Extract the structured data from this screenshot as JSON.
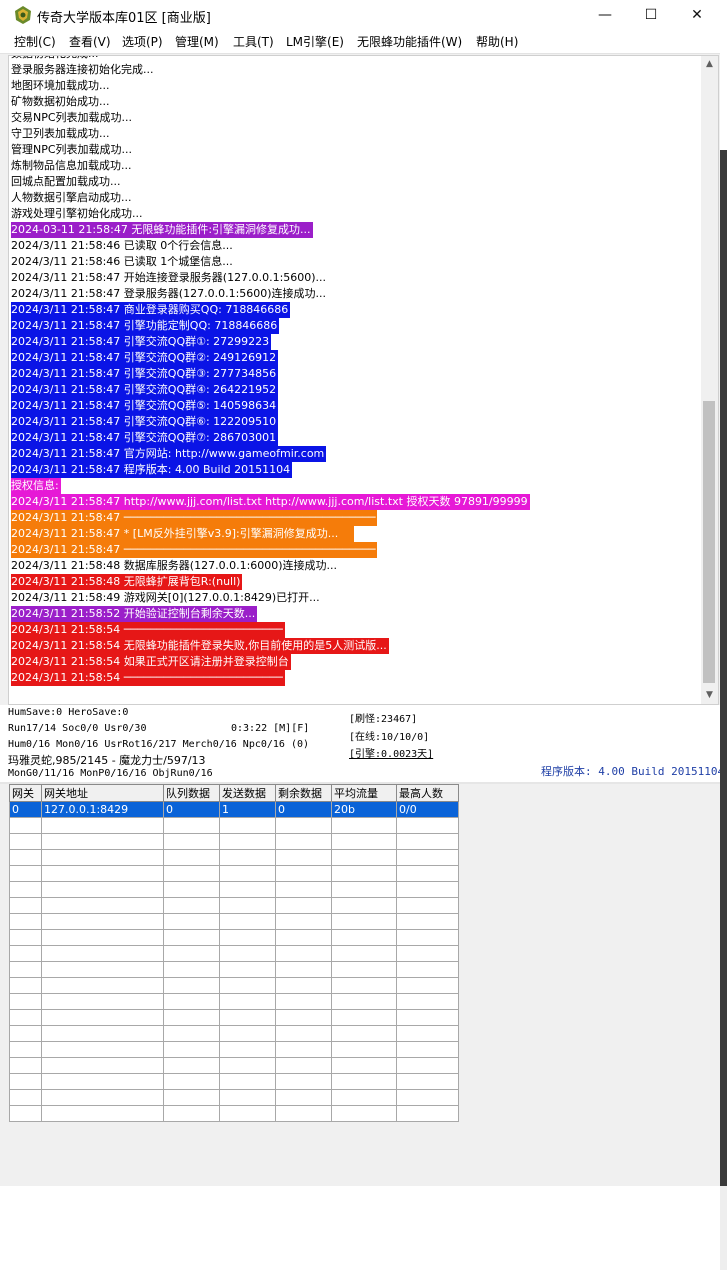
{
  "window": {
    "title": "传奇大学版本库01区 [商业版]",
    "minimize": "—",
    "maximize": "☐",
    "close": "✕"
  },
  "menu": [
    "控制(C)",
    "查看(V)",
    "选项(P)",
    "管理(M)",
    "工具(T)",
    "LM引擎(E)",
    "无限蜂功能插件(W)",
    "帮助(H)"
  ],
  "log": [
    {
      "text": "数据初始化完成...",
      "fg": "#000000",
      "bg": ""
    },
    {
      "text": "登录服务器连接初始化完成...",
      "fg": "#000000",
      "bg": ""
    },
    {
      "text": "地图环境加载成功...",
      "fg": "#000000",
      "bg": ""
    },
    {
      "text": "矿物数据初始成功...",
      "fg": "#000000",
      "bg": ""
    },
    {
      "text": "交易NPC列表加载成功...",
      "fg": "#000000",
      "bg": ""
    },
    {
      "text": "守卫列表加载成功...",
      "fg": "#000000",
      "bg": ""
    },
    {
      "text": "管理NPC列表加载成功...",
      "fg": "#000000",
      "bg": ""
    },
    {
      "text": "炼制物品信息加载成功...",
      "fg": "#000000",
      "bg": ""
    },
    {
      "text": "回城点配置加载成功...",
      "fg": "#000000",
      "bg": ""
    },
    {
      "text": "人物数据引擎启动成功...",
      "fg": "#000000",
      "bg": ""
    },
    {
      "text": "游戏处理引擎初始化成功...",
      "fg": "#000000",
      "bg": ""
    },
    {
      "text": "2024-03-11 21:58:47 无限蜂功能插件:引擎漏洞修复成功...",
      "fg": "#ffffff",
      "bg": "#9b1fc9"
    },
    {
      "text": "2024/3/11 21:58:46 已读取 0个行会信息...",
      "fg": "#000000",
      "bg": ""
    },
    {
      "text": "2024/3/11 21:58:46 已读取 1个城堡信息...",
      "fg": "#000000",
      "bg": ""
    },
    {
      "text": "2024/3/11 21:58:47 开始连接登录服务器(127.0.0.1:5600)...",
      "fg": "#000000",
      "bg": ""
    },
    {
      "text": "2024/3/11 21:58:47 登录服务器(127.0.0.1:5600)连接成功...",
      "fg": "#000000",
      "bg": ""
    },
    {
      "text": "2024/3/11 21:58:47 商业登录器购买QQ: 718846686",
      "fg": "#ffffff",
      "bg": "#0a14e6"
    },
    {
      "text": "2024/3/11 21:58:47 引擎功能定制QQ: 718846686",
      "fg": "#ffffff",
      "bg": "#0a14e6"
    },
    {
      "text": "2024/3/11 21:58:47 引擎交流QQ群①: 27299223",
      "fg": "#ffffff",
      "bg": "#0a14e6"
    },
    {
      "text": "2024/3/11 21:58:47 引擎交流QQ群②: 249126912",
      "fg": "#ffffff",
      "bg": "#0a14e6"
    },
    {
      "text": "2024/3/11 21:58:47 引擎交流QQ群③: 277734856",
      "fg": "#ffffff",
      "bg": "#0a14e6"
    },
    {
      "text": "2024/3/11 21:58:47 引擎交流QQ群④: 264221952",
      "fg": "#ffffff",
      "bg": "#0a14e6"
    },
    {
      "text": "2024/3/11 21:58:47 引擎交流QQ群⑤: 140598634",
      "fg": "#ffffff",
      "bg": "#0a14e6"
    },
    {
      "text": "2024/3/11 21:58:47 引擎交流QQ群⑥: 122209510",
      "fg": "#ffffff",
      "bg": "#0a14e6"
    },
    {
      "text": "2024/3/11 21:58:47 引擎交流QQ群⑦: 286703001",
      "fg": "#ffffff",
      "bg": "#0a14e6"
    },
    {
      "text": "2024/3/11 21:58:47 官方网站: http://www.gameofmir.com",
      "fg": "#ffffff",
      "bg": "#0a14e6"
    },
    {
      "text": "2024/3/11 21:58:47 程序版本: 4.00 Build 20151104",
      "fg": "#ffffff",
      "bg": "#0a14e6"
    },
    {
      "text": "授权信息:",
      "fg": "#ffffff",
      "bg": "#e619d6"
    },
    {
      "text": "2024/3/11 21:58:47 http://www.jjj.com/list.txt http://www.jjj.com/list.txt 授权天数 97891/99999",
      "fg": "#ffffff",
      "bg": "#e619d6"
    },
    {
      "text": "2024/3/11 21:58:47 ──────────────────────────────────────",
      "fg": "#ffffff",
      "bg": "#f57c0a"
    },
    {
      "text": "2024/3/11 21:58:47 * [LM反外挂引擎v3.9]:引擎漏洞修复成功...    ",
      "fg": "#ffffff",
      "bg": "#f57c0a"
    },
    {
      "text": "2024/3/11 21:58:47 ──────────────────────────────────────",
      "fg": "#ffffff",
      "bg": "#f57c0a"
    },
    {
      "text": "2024/3/11 21:58:48 数据库服务器(127.0.0.1:6000)连接成功...",
      "fg": "#000000",
      "bg": ""
    },
    {
      "text": "2024/3/11 21:58:48 无限蜂扩展背包R:(null)",
      "fg": "#ffffff",
      "bg": "#e61717"
    },
    {
      "text": "2024/3/11 21:58:49 游戏网关[0](127.0.0.1:8429)已打开...",
      "fg": "#000000",
      "bg": ""
    },
    {
      "text": "2024/3/11 21:58:52 开始验证控制台剩余天数...",
      "fg": "#ffffff",
      "bg": "#9b1fc9"
    },
    {
      "text": "2024/3/11 21:58:54 ────────────────────────",
      "fg": "#ffffff",
      "bg": "#e61717"
    },
    {
      "text": "2024/3/11 21:58:54 无限蜂功能插件登录失败,你目前使用的是5人测试版...",
      "fg": "#ffffff",
      "bg": "#e61717"
    },
    {
      "text": "2024/3/11 21:58:54 如果正式开区请注册并登录控制台",
      "fg": "#ffffff",
      "bg": "#e61717"
    },
    {
      "text": "2024/3/11 21:58:54 ────────────────────────",
      "fg": "#ffffff",
      "bg": "#e61717"
    }
  ],
  "status": {
    "line1": "HumSave:0 HeroSave:0",
    "line2": "Run17/14 Soc0/0 Usr0/30",
    "time": "0:3:22 [M][F]",
    "line3": "Hum0/16 Mon0/16 UsrRot16/217 Merch0/16 Npc0/16 (0)",
    "line4": "玛雅灵蛇,985/2145 - 魔龙力士/597/13",
    "line5": "MonG0/11/16 MonP0/16/16 ObjRun0/16",
    "refresh": "[刷怪:23467]",
    "online": "[在线:10/10/0]",
    "engine": "[引擎:0.0023天]",
    "version": "程序版本: 4.00 Build 20151104"
  },
  "grid": {
    "headers": [
      "网关",
      "网关地址",
      "队列数据",
      "发送数据",
      "剩余数据",
      "平均流量",
      "最高人数"
    ],
    "rows": [
      [
        "0",
        "127.0.0.1:8429",
        "0",
        "1",
        "0",
        "20b",
        "0/0"
      ]
    ],
    "empty_rows": 19
  },
  "colors": {
    "purple": "#9b1fc9",
    "blue": "#0a14e6",
    "magenta": "#e619d6",
    "orange": "#f57c0a",
    "red": "#e61717",
    "selection": "#0a63d8",
    "version_text": "#1f3fa6"
  }
}
